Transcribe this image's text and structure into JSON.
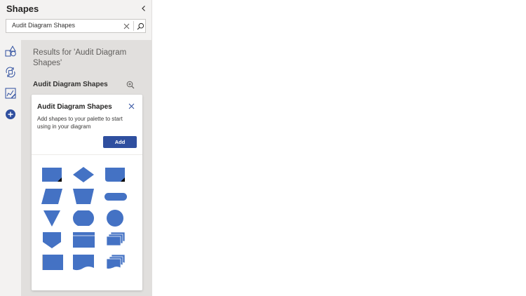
{
  "pane": {
    "title": "Shapes",
    "collapse_icon": "chevron-left-icon"
  },
  "search": {
    "value": "Audit Diagram Shapes",
    "clear_icon": "close-icon",
    "search_icon": "search-icon"
  },
  "rail": {
    "items": [
      {
        "name": "basic-shapes",
        "icon": "shapes-icon"
      },
      {
        "name": "recent",
        "icon": "refresh-icon"
      },
      {
        "name": "drawing",
        "icon": "pencil-board-icon"
      },
      {
        "name": "add-more",
        "icon": "add-circle-icon"
      }
    ]
  },
  "results": {
    "title": "Results for 'Audit Diagram Shapes'",
    "stencil_name": "Audit Diagram Shapes",
    "zoom_icon": "zoom-in-icon"
  },
  "card": {
    "title": "Audit Diagram Shapes",
    "description": "Add shapes to your palette to start using in your diagram",
    "add_label": "Add",
    "close_icon": "close-icon"
  },
  "colors": {
    "shape_fill": "#4472c4",
    "accent": "#2f4f9f"
  },
  "shapes": [
    "process-shape",
    "decision-shape",
    "document-shape",
    "data-shape",
    "manual-operation-shape",
    "terminator-shape",
    "merge-shape",
    "display-shape",
    "connector-shape",
    "off-page-reference-shape",
    "internal-storage-shape",
    "multiple-documents-shape",
    "bordered-process-shape",
    "document-curve-shape",
    "multi-document-curve-shape"
  ]
}
